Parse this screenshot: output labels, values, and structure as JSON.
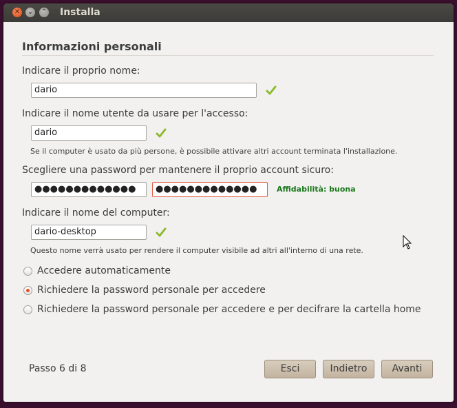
{
  "window": {
    "title": "Installa"
  },
  "section": {
    "title": "Informazioni personali"
  },
  "name": {
    "label": "Indicare il proprio nome:",
    "value": "dario"
  },
  "username": {
    "label": "Indicare il nome utente da usare per l'accesso:",
    "value": "dario",
    "hint": "Se il computer è usato da più persone, è possibile attivare altri account terminata l'installazione."
  },
  "password": {
    "label": "Scegliere una password per mantenere il proprio account sicuro:",
    "value_masked": "●●●●●●●●●●●●●",
    "confirm_masked": "●●●●●●●●●●●●●",
    "strength": "Affidabilità: buona"
  },
  "computer": {
    "label": "Indicare il nome del computer:",
    "value": "dario-desktop",
    "hint": "Questo nome verrà usato per rendere il computer visibile ad altri all'interno di una rete."
  },
  "login_options": [
    {
      "label": "Accedere automaticamente",
      "selected": false
    },
    {
      "label": "Richiedere la password personale per accedere",
      "selected": true
    },
    {
      "label": "Richiedere la password personale per accedere e per decifrare la cartella home",
      "selected": false
    }
  ],
  "footer": {
    "step": "Passo 6 di 8",
    "quit": "Esci",
    "back": "Indietro",
    "forward": "Avanti"
  },
  "colors": {
    "accent": "#e0502b",
    "strength": "#1d7a1d",
    "check": "#8dbb2e"
  }
}
